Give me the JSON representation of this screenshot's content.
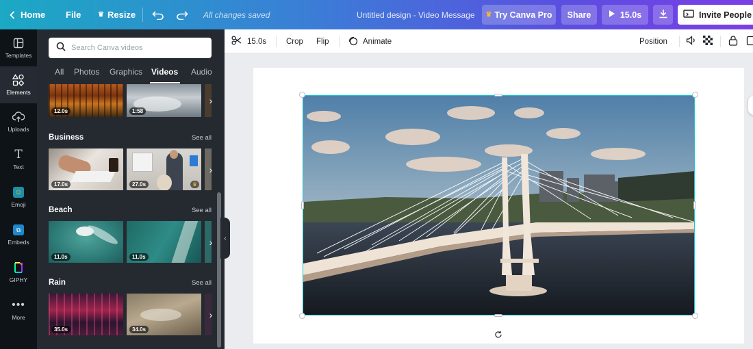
{
  "topbar": {
    "home": "Home",
    "file": "File",
    "resize": "Resize",
    "save_status": "All changes saved",
    "design_title": "Untitled design - Video Message",
    "try_pro": "Try Canva Pro",
    "share": "Share",
    "play_duration": "15.0s",
    "invite": "Invite People",
    "pro_color": "#f5b933"
  },
  "rail": {
    "items": [
      {
        "label": "Templates",
        "icon": "templates-icon"
      },
      {
        "label": "Elements",
        "icon": "elements-icon",
        "active": true
      },
      {
        "label": "Uploads",
        "icon": "upload-cloud-icon"
      },
      {
        "label": "Text",
        "icon": "text-icon"
      },
      {
        "label": "Emoji",
        "icon": "emoji-icon"
      },
      {
        "label": "Embeds",
        "icon": "embeds-icon"
      },
      {
        "label": "GIPHY",
        "icon": "giphy-icon"
      },
      {
        "label": "More",
        "icon": "more-dots-icon"
      }
    ]
  },
  "panel": {
    "search_placeholder": "Search Canva videos",
    "tabs": [
      "All",
      "Photos",
      "Graphics",
      "Videos",
      "Audio"
    ],
    "active_tab": "Videos",
    "see_all": "See all",
    "top_row": {
      "durations": [
        "12.0s",
        "1:58"
      ]
    },
    "sections": [
      {
        "title": "Business",
        "durations": [
          "17.0s",
          "27.0s"
        ],
        "pro_second": true
      },
      {
        "title": "Beach",
        "durations": [
          "11.0s",
          "11.0s"
        ]
      },
      {
        "title": "Rain",
        "durations": [
          "35.0s",
          "34.0s"
        ]
      }
    ]
  },
  "toolbar": {
    "duration": "15.0s",
    "crop": "Crop",
    "flip": "Flip",
    "animate": "Animate",
    "position": "Position"
  },
  "colors": {
    "selection": "#14c6d6",
    "panel_bg": "#252a31",
    "rail_bg": "#0e1318"
  }
}
